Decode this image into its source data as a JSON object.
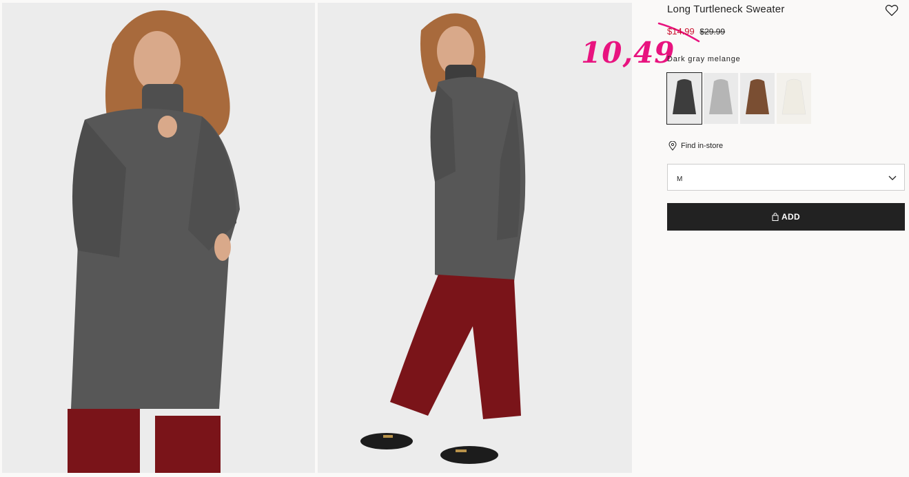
{
  "product": {
    "title": "Long Turtleneck Sweater",
    "price_sale": "$14.99",
    "price_original": "$29.99",
    "handwritten_price": "10,49",
    "color_name": "Dark gray melange",
    "swatches": [
      {
        "color": "#3d3d3d",
        "label": "dark gray"
      },
      {
        "color": "#b5b5b5",
        "label": "light gray"
      },
      {
        "color": "#7a4e32",
        "label": "brown"
      },
      {
        "color": "#efece3",
        "label": "cream"
      }
    ],
    "find_in_store": "Find in-store",
    "size_value": "M",
    "add_label": "ADD"
  },
  "colors": {
    "sale": "#c8102e",
    "annotation": "#e8137f",
    "button": "#222222",
    "sweater": "#555555",
    "trousers": "#7a1419"
  }
}
